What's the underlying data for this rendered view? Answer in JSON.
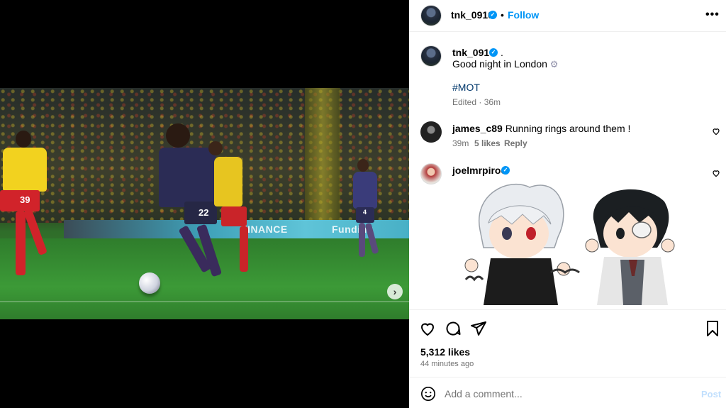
{
  "post": {
    "author": "tnk_0910",
    "follow_label": "Follow",
    "bullet": "•",
    "caption_line1": "Good night in London",
    "caption_dot": ".",
    "hashtag": "#MOT",
    "edited": "Edited · 36m",
    "media_dots": 2,
    "active_dot": 0
  },
  "photo": {
    "board_text_1": "FINANCE",
    "board_text_2": "Funding",
    "player_number": "22",
    "opponent_number": "39",
    "far_player_number": "4"
  },
  "comments": [
    {
      "user": "james_c89",
      "text": "Running rings around them !",
      "time": "39m",
      "likes": "5 likes",
      "reply": "Reply"
    },
    {
      "user": "joelmrpiroe",
      "verified": true,
      "attachment": "anime-sticker"
    }
  ],
  "actions": {
    "likes": "5,312 likes",
    "time_ago": "44 minutes ago"
  },
  "compose": {
    "placeholder": "Add a comment...",
    "post_label": "Post"
  },
  "icons": [
    "more-icon",
    "heart-icon",
    "comment-icon",
    "share-icon",
    "bookmark-icon",
    "emoji-icon",
    "verified-icon",
    "next-icon"
  ],
  "colors": {
    "accent": "#0095f6",
    "muted": "#737373",
    "hashtag": "#00376b"
  }
}
